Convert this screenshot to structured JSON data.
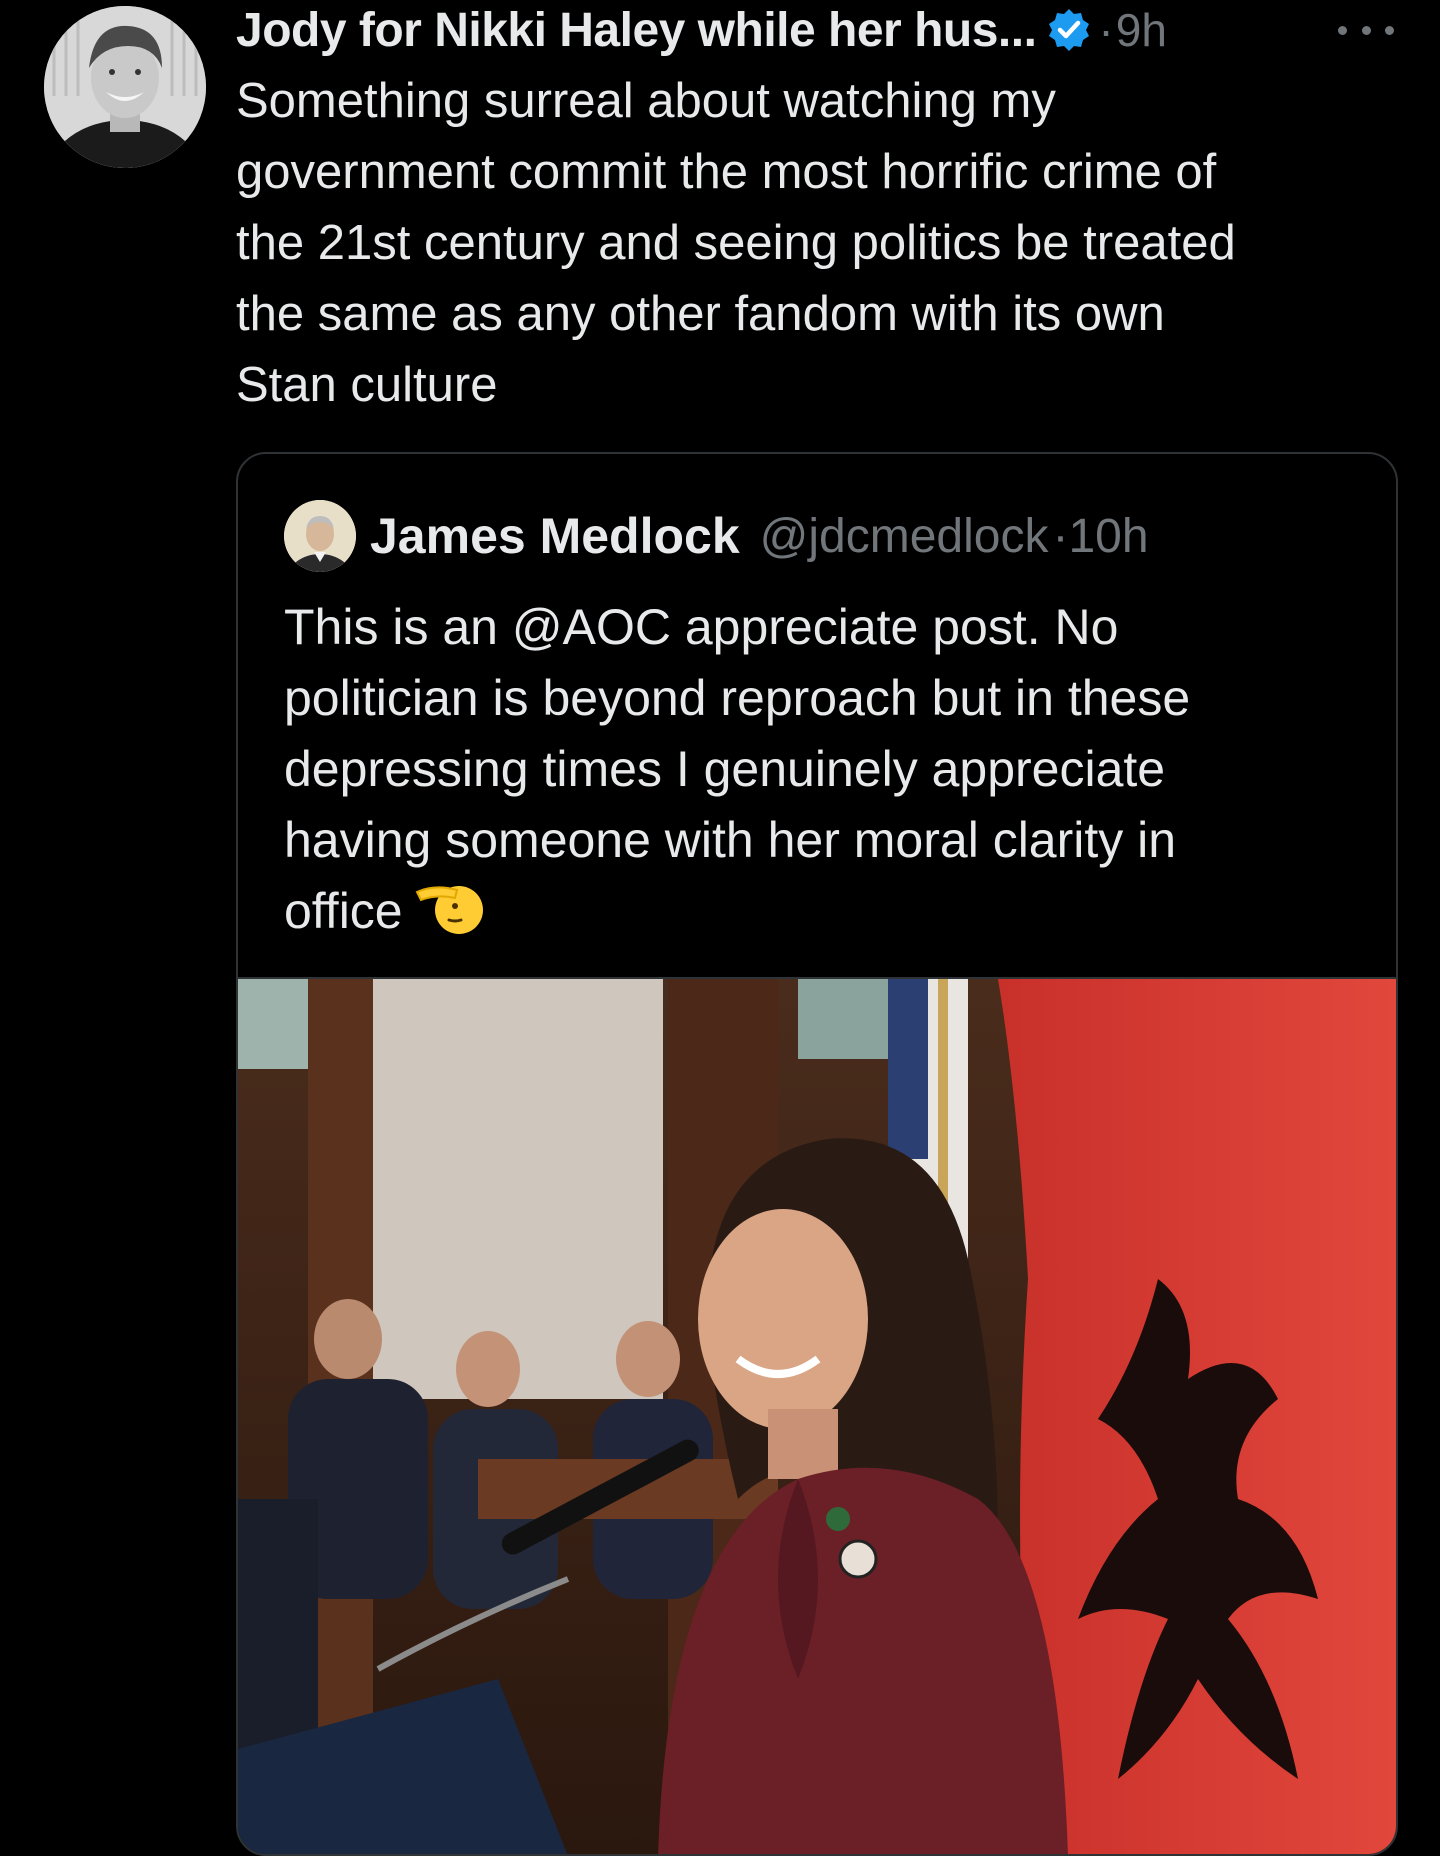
{
  "tweet": {
    "display_name": "Jody for Nikki Haley while her hus...",
    "verified_icon": "verified-badge-icon",
    "separator": "·",
    "timestamp": "9h",
    "more_icon": "more-options-icon",
    "text": "Something surreal about watching my\ngovernment commit the most horrific crime of\nthe 21st century and seeing politics be treated\nthe same as any other fandom with its own\nStan culture"
  },
  "quoted_tweet": {
    "display_name": "James Medlock",
    "handle": "@jdcmedlock",
    "separator": "·",
    "timestamp": "10h",
    "text": "This is an @AOC appreciate post. No\npolitician is beyond reproach but in these\ndepressing times I genuinely appreciate\nhaving someone with her moral clarity in\noffice",
    "emoji": "saluting-face-emoji",
    "media": "photo"
  },
  "colors": {
    "background": "#000000",
    "text_primary": "#e7e9ea",
    "text_secondary": "#71767b",
    "border": "#2f3336",
    "verified_blue": "#1d9bf0",
    "emoji_yellow": "#ffcc33"
  }
}
